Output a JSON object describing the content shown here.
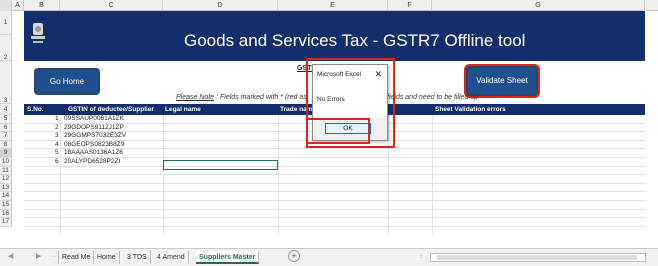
{
  "columns": [
    "A",
    "B",
    "C",
    "D",
    "E",
    "F",
    "G"
  ],
  "row_numbers": [
    "1",
    "2",
    "3",
    "4",
    "5",
    "6",
    "7",
    "8",
    "9",
    "10",
    "11",
    "12",
    "13",
    "14",
    "15",
    "16",
    "17"
  ],
  "banner": {
    "title": "Goods and Services Tax - GSTR7 Offline tool"
  },
  "buttons": {
    "go_home": "Go Home",
    "validate_sheet": "Validate Sheet"
  },
  "gstin_label": "GSTIN",
  "note": {
    "prefix": "Please Note",
    "text": " : Fields marked with * (red as",
    "suffix": "fields and need to be filled up"
  },
  "table": {
    "headers": [
      "S.No.",
      "GSTIN of deductee/Supplier",
      "Legal name",
      "Trade name (I",
      "Sheet Validation errors"
    ],
    "rows": [
      {
        "sno": "1",
        "gstin": "09SSAUP0061A1ZK"
      },
      {
        "sno": "2",
        "gstin": "29GDOPS9112J1ZP"
      },
      {
        "sno": "3",
        "gstin": "29GGMPS7032E3ZV"
      },
      {
        "sno": "4",
        "gstin": "08GEOPS0823B8Z9"
      },
      {
        "sno": "5",
        "gstin": "18AAAAS0136A1Z6"
      },
      {
        "sno": "6",
        "gstin": "20ALYPD6528P2ZI"
      }
    ]
  },
  "dialog": {
    "title": "Microsoft Excel",
    "close": "✕",
    "message": "No Errors",
    "ok": "OK"
  },
  "tabs": [
    "Read Me",
    "Home",
    "3 TDS",
    "4 Amend",
    "Suppliers Master"
  ],
  "active_tab": "Suppliers Master",
  "colors": {
    "banner": "#142e6b",
    "button": "#1f4f8c",
    "highlight": "#d9261c",
    "active_tab": "#1e7145"
  }
}
